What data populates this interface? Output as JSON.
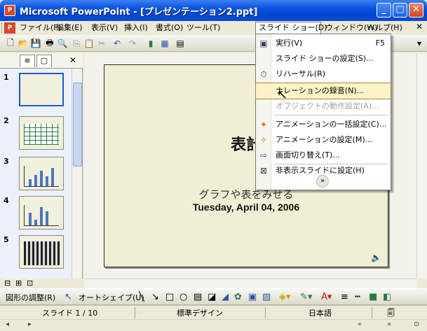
{
  "window": {
    "title": "Microsoft PowerPoint - [プレゼンテーション2.ppt]"
  },
  "menubar": {
    "items": [
      "ファイル(F)",
      "編集(E)",
      "表示(V)",
      "挿入(I)",
      "書式(O)",
      "ツール(T)",
      "スライド ショー(D)",
      "ウィンドウ(W)",
      "ヘルプ(H)"
    ]
  },
  "dropdown": {
    "items": [
      {
        "label": "実行(V)",
        "shortcut": "F5",
        "icon": "projector-icon",
        "state": "normal"
      },
      {
        "label": "スライド ショーの設定(S)...",
        "shortcut": "",
        "icon": "",
        "state": "normal"
      },
      {
        "label": "リハーサル(R)",
        "shortcut": "",
        "icon": "rehearse-icon",
        "state": "normal"
      },
      {
        "label": "ナレーションの録音(N)...",
        "shortcut": "",
        "icon": "",
        "state": "highlighted"
      },
      {
        "label": "オブジェクトの動作設定(A)...",
        "shortcut": "",
        "icon": "",
        "state": "disabled"
      },
      {
        "label": "アニメーションの一括設定(C)...",
        "shortcut": "",
        "icon": "animation-scheme-icon",
        "state": "normal"
      },
      {
        "label": "アニメーションの設定(M)...",
        "shortcut": "",
        "icon": "custom-animation-icon",
        "state": "normal"
      },
      {
        "label": "画面切り替え(T)...",
        "shortcut": "",
        "icon": "transition-icon",
        "state": "normal"
      },
      {
        "label": "非表示スライドに設定(H)",
        "shortcut": "",
        "icon": "hide-slide-icon",
        "state": "normal"
      }
    ]
  },
  "slide": {
    "title": "表計",
    "subtitle": "グラフや表をみせる",
    "date": "Tuesday, April 04, 2006"
  },
  "thumbnails": [
    {
      "number": "1"
    },
    {
      "number": "2"
    },
    {
      "number": "3"
    },
    {
      "number": "4"
    },
    {
      "number": "5"
    }
  ],
  "drawbar": {
    "draw_label": "図形の調整(R)",
    "autoshape_label": "オートシェイプ(U)"
  },
  "status": {
    "slide": "スライド 1 / 10",
    "design": "標準デザイン",
    "language": "日本語"
  },
  "colors": {
    "title_bar": "#0a54e0",
    "slide_bg": "#f0efd4",
    "menu_highlight": "#fdf3c6"
  }
}
